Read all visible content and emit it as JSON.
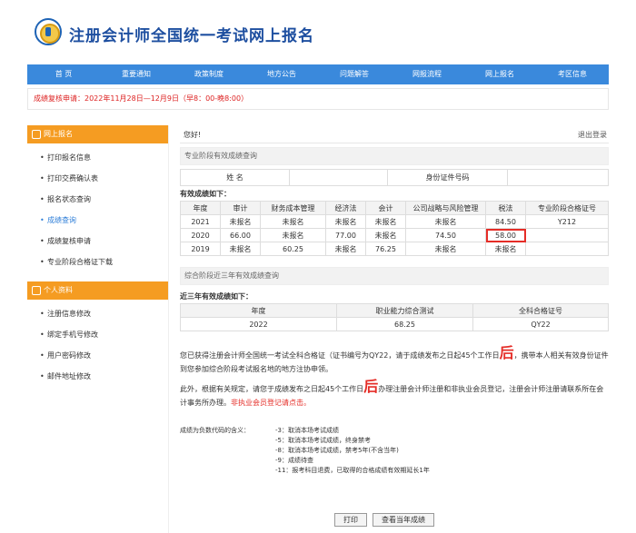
{
  "header": {
    "title": "注册会计师全国统一考试网上报名"
  },
  "nav": [
    "首 页",
    "重要通知",
    "政策制度",
    "地方公告",
    "问题解答",
    "网报流程",
    "网上报名",
    "考区信息"
  ],
  "notice": "成绩复核申请：2022年11月28日—12月9日（早8：00-晚8:00）",
  "left_menu": {
    "section1": "网上报名",
    "items1": [
      "打印报名信息",
      "打印交费确认表",
      "报名状态查询",
      "成绩查询",
      "成绩复核申请",
      "专业阶段合格证下载"
    ],
    "section2": "个人资料",
    "items2": [
      "注册信息修改",
      "绑定手机号修改",
      "用户密码修改",
      "邮件地址修改"
    ]
  },
  "content": {
    "welcome": "您好!",
    "logout": "退出登录",
    "pro_section": "专业阶段有效成绩查询",
    "name_label": "姓 名",
    "id_label": "身份证件号码",
    "valid_label": "有效成绩如下：",
    "table_headers": [
      "年度",
      "审计",
      "财务成本管理",
      "经济法",
      "会计",
      "公司战略与风险管理",
      "税法",
      "专业阶段合格证号"
    ],
    "rows": [
      [
        "2021",
        "未报名",
        "未报名",
        "未报名",
        "未报名",
        "未报名",
        "84.50",
        "Y212"
      ],
      [
        "2020",
        "66.00",
        "未报名",
        "77.00",
        "未报名",
        "74.50",
        "58.00",
        ""
      ],
      [
        "2019",
        "未报名",
        "60.25",
        "未报名",
        "76.25",
        "未报名",
        "未报名",
        ""
      ]
    ],
    "synthesis_section": "综合阶段近三年有效成绩查询",
    "synthesis_label": "近三年有效成绩如下：",
    "synthesis_headers": [
      "年度",
      "职业能力综合测试",
      "全科合格证号"
    ],
    "synthesis_row": [
      "2022",
      "68.25",
      "QY22"
    ],
    "para1a": "您已获得注册会计师全国统一考试全科合格证（证书编号为QY22",
    "para1b": "，请于成绩发布之日起45个工作",
    "para1c": "日",
    "para1d": "后",
    "para1e": "，携带本人相关有效身份证件到您参加综合阶段考试报名地的地方注协申领。",
    "para2a": "此外，根据有关规定，请您于成绩发布之日起45个工作日",
    "para2b": "后",
    "para2c": "办理注册会计师注册和非执业会员登记，注册会计师注册请联系所在会计事务所办理。",
    "para2link": "非执业会员登记请点击。",
    "notes_label": "成绩为负数代码的含义：",
    "notes": [
      "-3：取消本场考试成绩",
      "-5：取消本场考试成绩，终身禁考",
      "-8：取消本场考试成绩，禁考5年(不含当年)",
      "-9：成绩待查",
      "-11：报考科目退费，已取得的合格成绩有效期延长1年"
    ],
    "print_btn": "打印",
    "view_btn": "查看当年成绩"
  }
}
